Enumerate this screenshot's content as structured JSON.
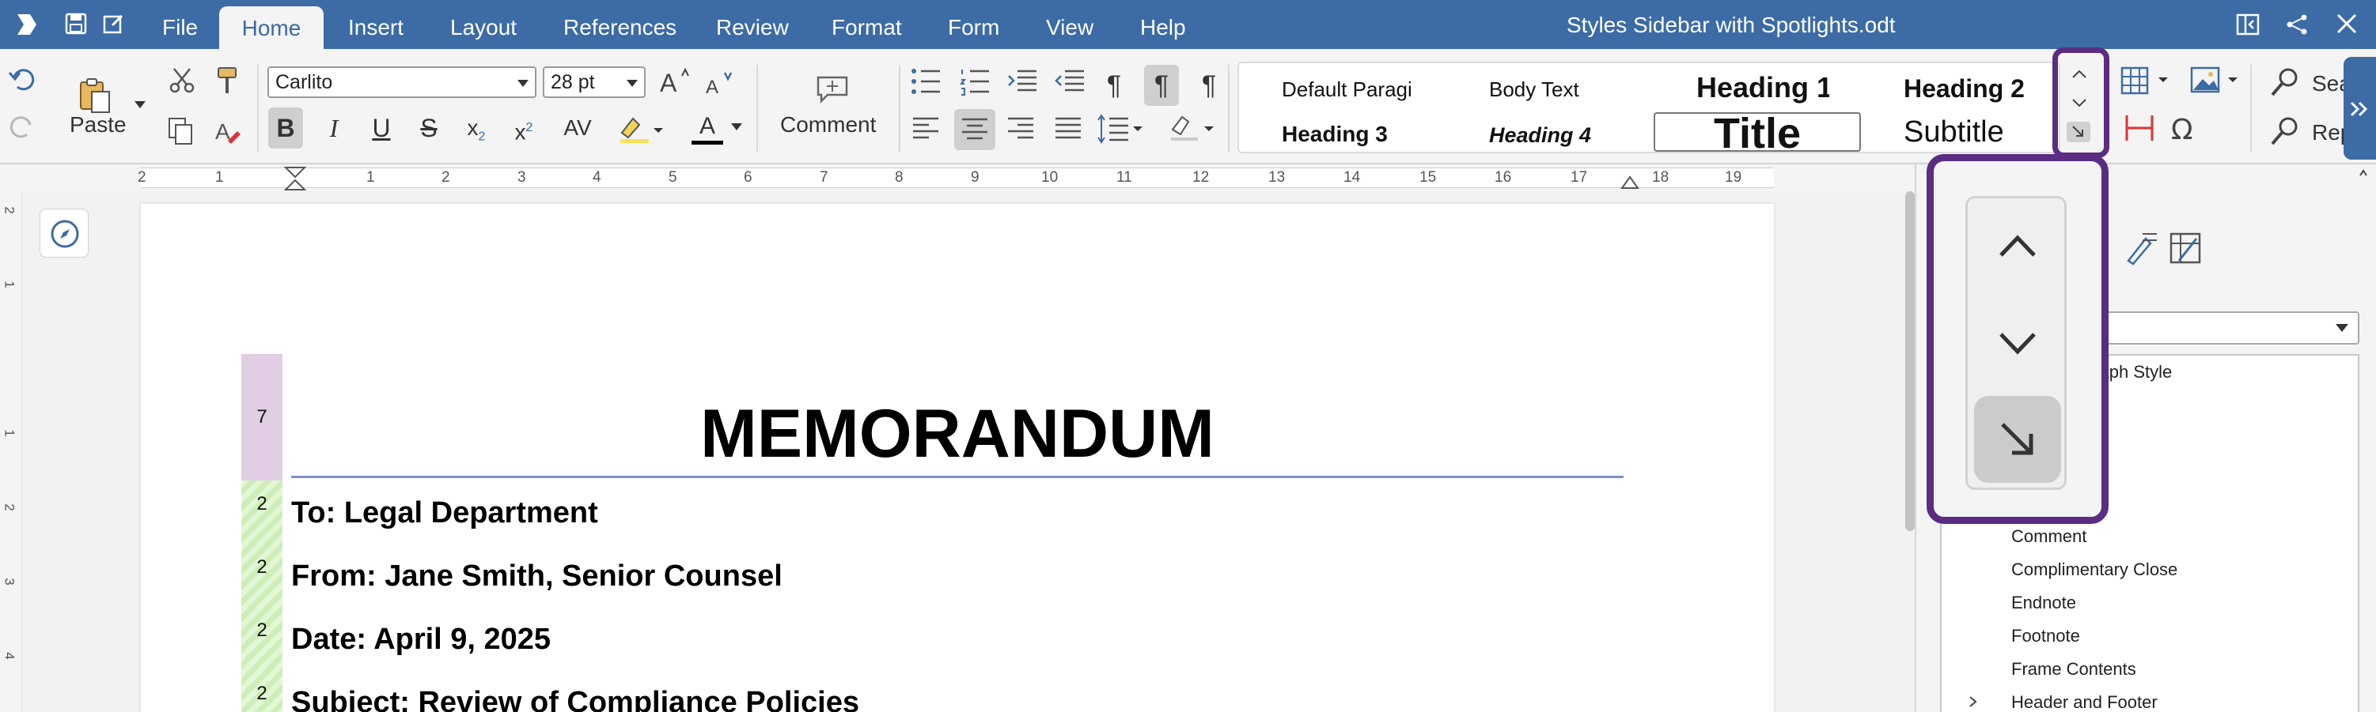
{
  "window": {
    "title": "Styles Sidebar with Spotlights.odt",
    "menu": [
      "File",
      "Home",
      "Insert",
      "Layout",
      "References",
      "Review",
      "Format",
      "Form",
      "View",
      "Help"
    ],
    "active_menu": "Home"
  },
  "toolbar": {
    "paste_label": "Paste",
    "comment_label": "Comment",
    "font_name": "Carlito",
    "font_size": "28 pt",
    "bold": "B",
    "italic": "I",
    "underline": "U",
    "strike": "S",
    "subscript": "x",
    "subscript_mark": "2",
    "superscript": "x",
    "superscript_mark": "2",
    "spacing": "AV",
    "font_color": "A",
    "search_label": "Sea",
    "replace_label": "Repl"
  },
  "style_gallery": [
    "Default Paragi",
    "Body Text",
    "Heading 1",
    "Heading 2",
    "Heading 3",
    "Heading 4",
    "Title",
    "Subtitle"
  ],
  "ruler": {
    "numbers": [
      "2",
      "1",
      "1",
      "2",
      "3",
      "4",
      "5",
      "6",
      "7",
      "8",
      "9",
      "10",
      "11",
      "12",
      "13",
      "14",
      "15",
      "16",
      "17",
      "18",
      "19"
    ],
    "vertical_numbers": [
      "2",
      "1",
      "1",
      "2",
      "3",
      "4"
    ]
  },
  "document": {
    "spotlight_heading": "7",
    "spotlight_body": [
      "2",
      "2",
      "2",
      "2"
    ],
    "title": "MEMORANDUM",
    "lines": [
      "To: Legal Department",
      "From: Jane Smith, Senior Counsel",
      "Date: April 9, 2025",
      "Subject: Review of Compliance Policies"
    ]
  },
  "sidebar": {
    "partial_header": "graph Style",
    "styles": [
      "Comment",
      "Complimentary Close",
      "Endnote",
      "Footnote",
      "Frame Contents",
      "Header and Footer"
    ]
  },
  "colors": {
    "titlebar": "#3c6ba5",
    "highlight": "#5a2d83",
    "heading_spotlight": "#e1cde4",
    "body_spotlight": "#d5f2c2"
  }
}
